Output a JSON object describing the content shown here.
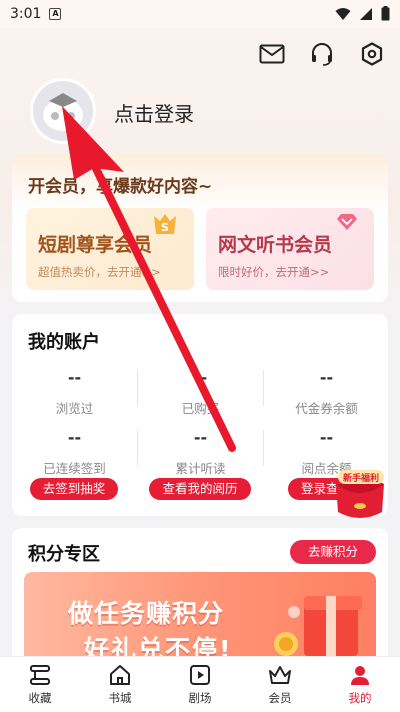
{
  "status_bar": {
    "time": "3:01",
    "notif": "A"
  },
  "profile": {
    "login_text": "点击登录"
  },
  "vip": {
    "title": "开会员，享爆款好内容~",
    "cards": [
      {
        "name": "短剧尊享会员",
        "sub": "超值热卖价，去开通>>",
        "badge": "S"
      },
      {
        "name": "网文听书会员",
        "sub": "限时好价，去开通>>",
        "badge": "diamond"
      }
    ]
  },
  "account": {
    "title": "我的账户",
    "stats": [
      {
        "value": "--",
        "label": "浏览过"
      },
      {
        "value": "--",
        "label": "已购买"
      },
      {
        "value": "--",
        "label": "代金券余额"
      },
      {
        "value": "--",
        "label": "已连续签到"
      },
      {
        "value": "--",
        "label": "累计听读"
      },
      {
        "value": "--",
        "label": "阅点余额"
      }
    ],
    "buttons": [
      "去签到抽奖",
      "查看我的阅历",
      "登录查看"
    ]
  },
  "float_gift": {
    "label": "新手福利"
  },
  "points": {
    "title": "积分专区",
    "earn_button": "去赚积分",
    "banner_line1": "做任务赚积分",
    "banner_line2": "好礼兑不停!"
  },
  "tabs": [
    {
      "label": "收藏",
      "icon": "bookshelf-icon"
    },
    {
      "label": "书城",
      "icon": "home-icon"
    },
    {
      "label": "剧场",
      "icon": "play-icon"
    },
    {
      "label": "会员",
      "icon": "crown-icon"
    },
    {
      "label": "我的",
      "icon": "person-icon",
      "active": true
    }
  ],
  "colors": {
    "accent": "#e51d35",
    "arrow": "#e8192c"
  }
}
